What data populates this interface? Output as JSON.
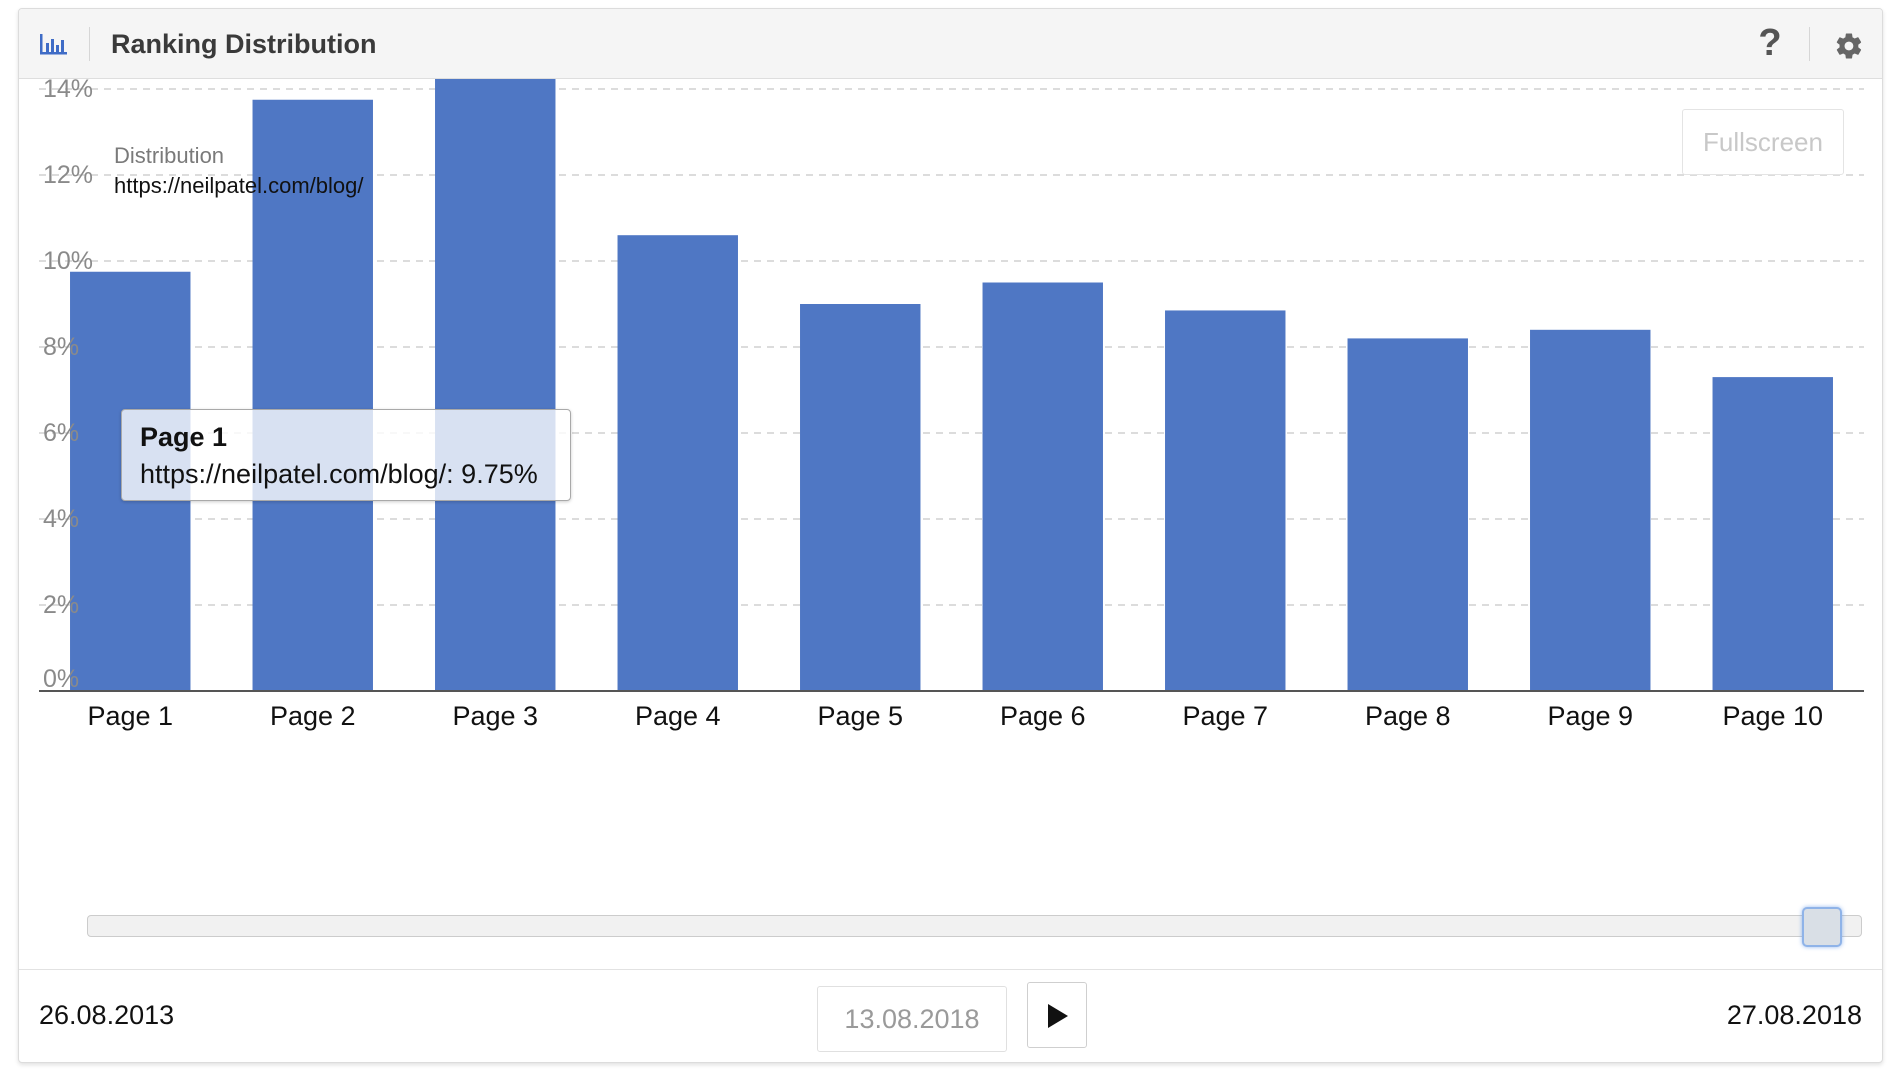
{
  "header": {
    "title": "Ranking Distribution",
    "help_label": "?",
    "icons": [
      "bar-chart-icon",
      "help-icon",
      "gear-icon"
    ]
  },
  "chart_data": {
    "type": "bar",
    "categories": [
      "Page 1",
      "Page 2",
      "Page 3",
      "Page 4",
      "Page 5",
      "Page 6",
      "Page 7",
      "Page 8",
      "Page 9",
      "Page 10"
    ],
    "series": [
      {
        "name": "https://neilpatel.com/blog/",
        "color": "#4f77c4",
        "values": [
          9.75,
          13.75,
          14.55,
          10.6,
          9.0,
          9.5,
          8.85,
          8.2,
          8.4,
          7.3
        ]
      }
    ],
    "ylim": [
      0,
      14
    ],
    "yticks": [
      0,
      2,
      4,
      6,
      8,
      10,
      12,
      14
    ],
    "ytick_labels": [
      "0%",
      "2%",
      "4%",
      "6%",
      "8%",
      "10%",
      "12%",
      "14%"
    ],
    "grid": true,
    "legend": {
      "title": "Distribution",
      "placement": "top-left"
    }
  },
  "fullscreen_label": "Fullscreen",
  "tooltip": {
    "title": "Page 1",
    "body": "https://neilpatel.com/blog/: 9.75%"
  },
  "timeline": {
    "start_date": "26.08.2013",
    "current_date": "13.08.2018",
    "end_date": "27.08.2018",
    "position": 1.0
  }
}
